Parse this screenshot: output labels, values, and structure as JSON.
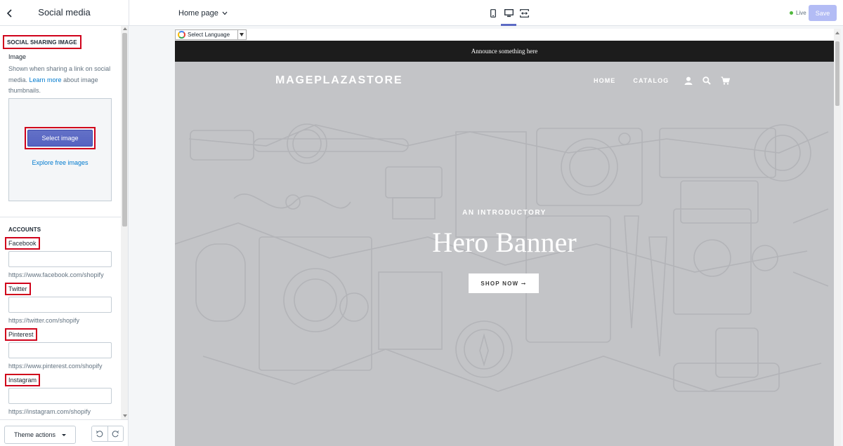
{
  "topbar": {
    "panel_title": "Social media",
    "page_selector": "Home page",
    "live_label": "Live",
    "save_label": "Save"
  },
  "sidebar": {
    "social_image": {
      "heading": "SOCIAL SHARING IMAGE",
      "label": "Image",
      "help_before": "Shown when sharing a link on social media.",
      "help_link": "Learn more",
      "help_after": "about image thumbnails.",
      "select_label": "Select image",
      "explore_label": "Explore free images"
    },
    "accounts": {
      "heading": "ACCOUNTS",
      "facebook": {
        "label": "Facebook",
        "value": "",
        "hint": "https://www.facebook.com/shopify"
      },
      "twitter": {
        "label": "Twitter",
        "value": "",
        "hint": "https://twitter.com/shopify"
      },
      "pinterest": {
        "label": "Pinterest",
        "value": "",
        "hint": "https://www.pinterest.com/shopify"
      },
      "instagram": {
        "label": "Instagram",
        "value": "",
        "hint": "https://instagram.com/shopify"
      }
    }
  },
  "bottombar": {
    "theme_actions": "Theme actions"
  },
  "preview": {
    "translate_label": "Select Language",
    "announcement": "Announce something here",
    "store_name": "MAGEPLAZASTORE",
    "nav": {
      "home": "HOME",
      "catalog": "CATALOG"
    },
    "hero_intro": "AN INTRODUCTORY",
    "hero_title": "Hero Banner",
    "shop_now": "SHOP NOW ➞"
  },
  "colors": {
    "accent": "#5c6ac4",
    "highlight_border": "#d0021b",
    "live_dot": "#50b83c",
    "save_disabled": "#b3bcf5",
    "announcement_bg": "#1c1c1c",
    "hero_bg": "#c3c4c7"
  }
}
